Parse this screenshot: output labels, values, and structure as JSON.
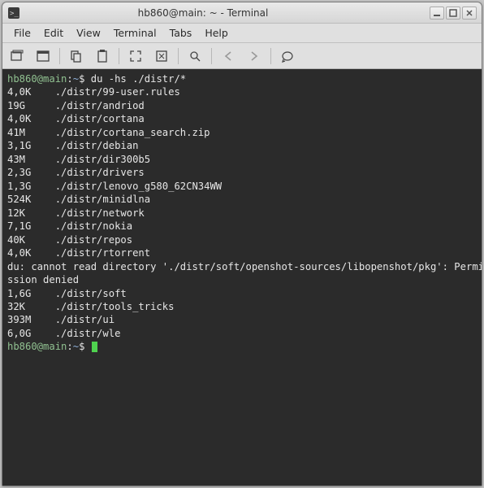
{
  "titlebar": {
    "title": "hb860@main: ~ - Terminal"
  },
  "menubar": {
    "items": [
      "File",
      "Edit",
      "View",
      "Terminal",
      "Tabs",
      "Help"
    ]
  },
  "toolbar": {
    "icons": [
      {
        "name": "new-tab-icon"
      },
      {
        "name": "new-window-icon"
      },
      {
        "name": "copy-icon"
      },
      {
        "name": "paste-icon"
      },
      {
        "name": "fullscreen-icon"
      },
      {
        "name": "zoom-icon"
      },
      {
        "name": "find-icon"
      },
      {
        "name": "prev-icon"
      },
      {
        "name": "next-icon"
      },
      {
        "name": "help-icon"
      }
    ]
  },
  "terminal": {
    "prompt_user_host": "hb860@main",
    "prompt_path": "~",
    "prompt_suffix": "$",
    "command": "du -hs ./distr/*",
    "lines": [
      "4,0K    ./distr/99-user.rules",
      "19G     ./distr/andriod",
      "4,0K    ./distr/cortana",
      "41M     ./distr/cortana_search.zip",
      "3,1G    ./distr/debian",
      "43M     ./distr/dir300b5",
      "2,3G    ./distr/drivers",
      "1,3G    ./distr/lenovo_g580_62CN34WW",
      "524K    ./distr/minidlna",
      "12K     ./distr/network",
      "7,1G    ./distr/nokia",
      "40K     ./distr/repos",
      "4,0K    ./distr/rtorrent",
      "du: cannot read directory './distr/soft/openshot-sources/libopenshot/pkg': Permi",
      "ssion denied",
      "1,6G    ./distr/soft",
      "32K     ./distr/tools_tricks",
      "393M    ./distr/ui",
      "6,0G    ./distr/wle"
    ]
  }
}
